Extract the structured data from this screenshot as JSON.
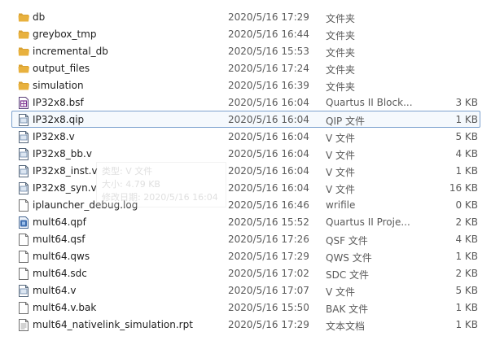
{
  "files": [
    {
      "name": "db",
      "date": "2020/5/16 17:29",
      "type": "文件夹",
      "size": "",
      "icon": "folder-icon"
    },
    {
      "name": "greybox_tmp",
      "date": "2020/5/16 16:44",
      "type": "文件夹",
      "size": "",
      "icon": "folder-icon"
    },
    {
      "name": "incremental_db",
      "date": "2020/5/16 15:53",
      "type": "文件夹",
      "size": "",
      "icon": "folder-icon"
    },
    {
      "name": "output_files",
      "date": "2020/5/16 17:24",
      "type": "文件夹",
      "size": "",
      "icon": "folder-icon"
    },
    {
      "name": "simulation",
      "date": "2020/5/16 16:39",
      "type": "文件夹",
      "size": "",
      "icon": "folder-icon"
    },
    {
      "name": "IP32x8.bsf",
      "date": "2020/5/16 16:04",
      "type": "Quartus II Block...",
      "size": "3 KB",
      "icon": "quartus-block-file-icon"
    },
    {
      "name": "IP32x8.qip",
      "date": "2020/5/16 16:04",
      "type": "QIP 文件",
      "size": "1 KB",
      "icon": "document-icon",
      "selected": true
    },
    {
      "name": "IP32x8.v",
      "date": "2020/5/16 16:04",
      "type": "V 文件",
      "size": "5 KB",
      "icon": "document-icon"
    },
    {
      "name": "IP32x8_bb.v",
      "date": "2020/5/16 16:04",
      "type": "V 文件",
      "size": "4 KB",
      "icon": "document-icon"
    },
    {
      "name": "IP32x8_inst.v",
      "date": "2020/5/16 16:04",
      "type": "V 文件",
      "size": "1 KB",
      "icon": "document-icon"
    },
    {
      "name": "IP32x8_syn.v",
      "date": "2020/5/16 16:04",
      "type": "V 文件",
      "size": "16 KB",
      "icon": "document-icon"
    },
    {
      "name": "iplauncher_debug.log",
      "date": "2020/5/16 16:46",
      "type": "wrifile",
      "size": "0 KB",
      "icon": "blank-file-icon"
    },
    {
      "name": "mult64.qpf",
      "date": "2020/5/16 15:52",
      "type": "Quartus II Proje...",
      "size": "2 KB",
      "icon": "quartus-project-icon"
    },
    {
      "name": "mult64.qsf",
      "date": "2020/5/16 17:26",
      "type": "QSF 文件",
      "size": "4 KB",
      "icon": "blank-file-icon"
    },
    {
      "name": "mult64.qws",
      "date": "2020/5/16 17:29",
      "type": "QWS 文件",
      "size": "1 KB",
      "icon": "blank-file-icon"
    },
    {
      "name": "mult64.sdc",
      "date": "2020/5/16 17:02",
      "type": "SDC 文件",
      "size": "2 KB",
      "icon": "blank-file-icon"
    },
    {
      "name": "mult64.v",
      "date": "2020/5/16 17:07",
      "type": "V 文件",
      "size": "5 KB",
      "icon": "document-icon"
    },
    {
      "name": "mult64.v.bak",
      "date": "2020/5/16 15:50",
      "type": "BAK 文件",
      "size": "1 KB",
      "icon": "blank-file-icon"
    },
    {
      "name": "mult64_nativelink_simulation.rpt",
      "date": "2020/5/16 17:29",
      "type": "文本文档",
      "size": "1 KB",
      "icon": "text-document-icon"
    }
  ],
  "tooltip": {
    "line1": "类型: V 文件",
    "line2": "大小: 4.79 KB",
    "line3": "修改日期: 2020/5/16 16:04"
  },
  "colors": {
    "folder": "#e8b13e",
    "selection_border": "#7da2ce",
    "secondary_text": "#5b5b5b"
  }
}
